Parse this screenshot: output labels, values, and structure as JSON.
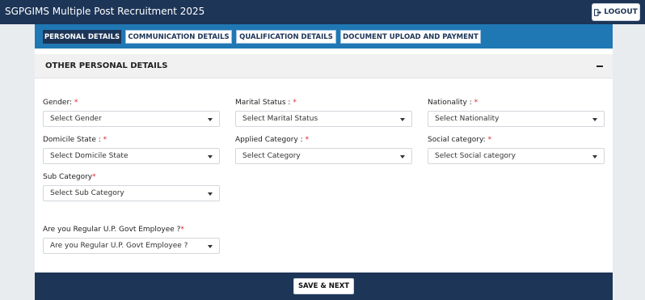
{
  "header": {
    "title": "SGPGIMS Multiple Post Recruitment 2025",
    "logout_label": "LOGOUT"
  },
  "tabs": [
    {
      "label": "PERSONAL DETAILS",
      "active": true
    },
    {
      "label": "COMMUNICATION DETAILS",
      "active": false
    },
    {
      "label": "QUALIFICATION DETAILS",
      "active": false
    },
    {
      "label": "DOCUMENT UPLOAD AND PAYMENT",
      "active": false
    }
  ],
  "section": {
    "title": "OTHER PERSONAL DETAILS"
  },
  "fields": {
    "gender": {
      "label": "Gender:",
      "required": "*",
      "value": "Select Gender"
    },
    "marital_status": {
      "label": "Marital Status :",
      "required": "*",
      "value": "Select Marital Status"
    },
    "nationality": {
      "label": "Nationality :",
      "required": "*",
      "value": "Select Nationality"
    },
    "domicile_state": {
      "label": "Domicile State :",
      "required": "*",
      "value": "Select Domicile State"
    },
    "applied_category": {
      "label": "Applied Category :",
      "required": "*",
      "value": "Select Category"
    },
    "social_category": {
      "label": "Social category:",
      "required": "*",
      "value": "Select Social category"
    },
    "sub_category": {
      "label": "Sub Category",
      "required": "*",
      "value": "Select Sub Category"
    },
    "regular_govt_employee": {
      "label": "Are you Regular U.P. Govt Employee ?",
      "required": "*",
      "value": "Are you Regular U.P. Govt Employee ?"
    }
  },
  "footer": {
    "save_label": "SAVE & NEXT"
  },
  "colors": {
    "navy": "#1d3557",
    "tab_bar_blue": "#1f78b4",
    "required_red": "#d62828"
  }
}
